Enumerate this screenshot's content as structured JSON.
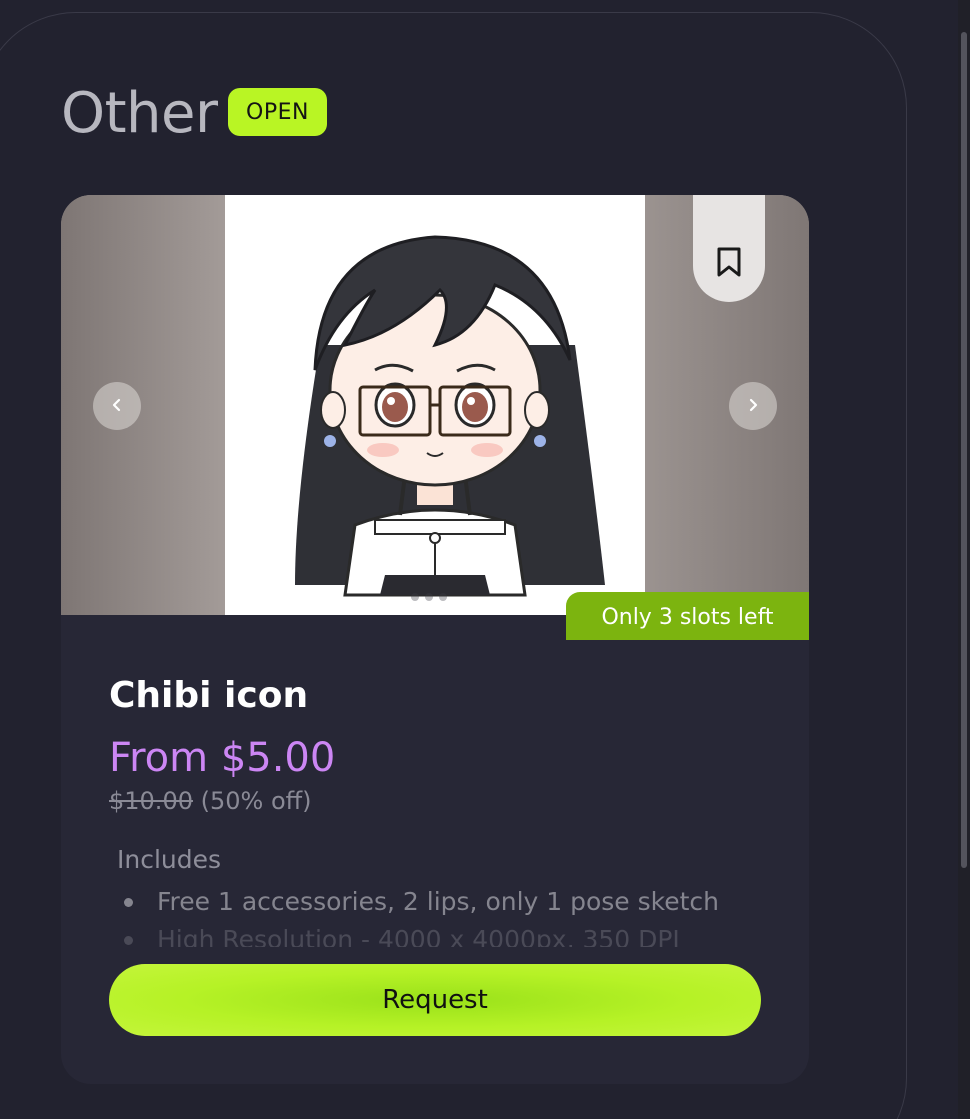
{
  "section": {
    "title": "Other",
    "status_badge": "OPEN"
  },
  "card": {
    "title": "Chibi icon",
    "price": "From $5.00",
    "original_price": "$10.00",
    "discount": "(50% off)",
    "slots_badge": "Only 3 slots left",
    "includes_label": "Includes",
    "includes": [
      "Free 1 accessories, 2 lips, only 1 pose sketch",
      "High Resolution - 4000 x 4000px, 350 DPI"
    ],
    "request_label": "Request",
    "gallery": {
      "image": "chibi-girl-with-glasses-artwork",
      "prev_icon": "chevron-left-icon",
      "next_icon": "chevron-right-icon",
      "bookmark_icon": "bookmark-icon"
    }
  },
  "colors": {
    "background": "#22222f",
    "card": "#272736",
    "accent_green": "#b9f524",
    "slots_green": "#7cb40f",
    "price_purple": "#cc86f4"
  }
}
